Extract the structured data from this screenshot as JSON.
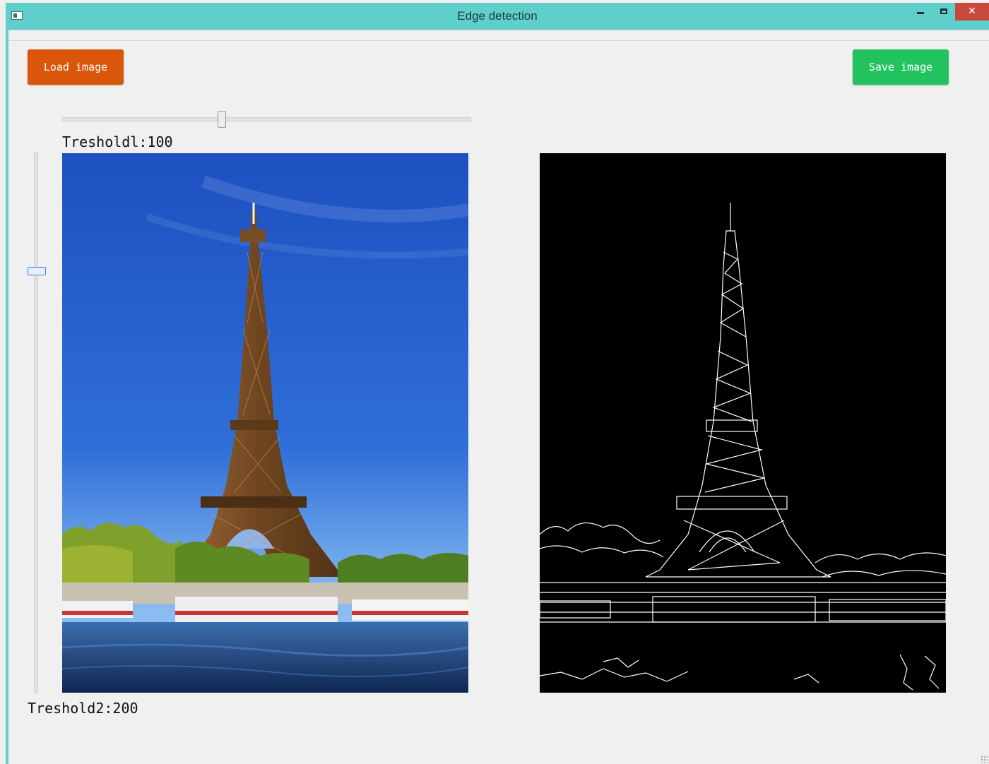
{
  "window": {
    "title": "Edge detection",
    "close_glyph": "✕",
    "icons": {
      "app": "window-icon",
      "minimize": "minimize-icon",
      "maximize": "maximize-icon",
      "close": "close-icon"
    },
    "colors": {
      "titlebar": "#5ecfcb",
      "close": "#c9483d",
      "background": "#f0f0f0"
    }
  },
  "toolbar": {
    "load_label": "Load image",
    "save_label": "Save image",
    "colors": {
      "load": "#d9560a",
      "save": "#22c35f"
    }
  },
  "threshold1": {
    "label": "Tresholdl:100",
    "value": 100,
    "max": 255
  },
  "threshold2": {
    "label": "Treshold2:200",
    "value": 200,
    "max": 255,
    "level_fraction": 0.22
  },
  "images": {
    "original": {
      "subject": "eiffel-tower-photo",
      "colors": {
        "sky": "#1d4fc0",
        "tower": "#8a5a2b",
        "trees": "#6f9b2a",
        "river": "#1d3e7a"
      }
    },
    "edges": {
      "subject": "eiffel-tower-edges",
      "colors": {
        "background": "#000000",
        "edges": "#ffffff"
      }
    }
  }
}
